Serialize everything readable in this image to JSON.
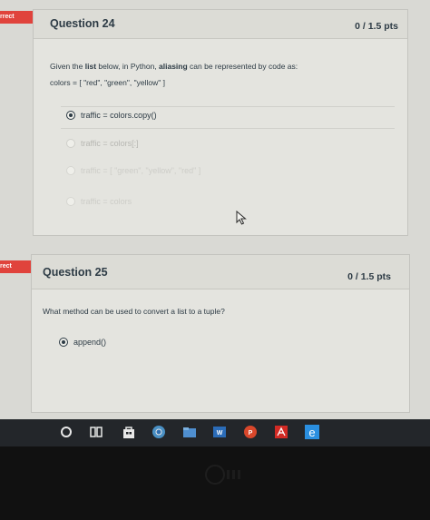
{
  "question24": {
    "status": "rrect",
    "title": "Question 24",
    "points": "0 / 1.5 pts",
    "prompt_start": "Given the ",
    "prompt_bold1": "list",
    "prompt_mid": " below, in Python, ",
    "prompt_bold2": "aliasing",
    "prompt_end": " can be represented by code as:",
    "code_line": "colors = [ \"red\", \"green\", \"yellow\" ]",
    "answers": [
      {
        "label": "traffic = colors.copy()",
        "selected": true
      },
      {
        "label": "traffic = colors[:]",
        "selected": false
      },
      {
        "label": "traffic = [ \"green\", \"yellow\", \"red\" ]",
        "selected": false
      },
      {
        "label": "traffic = colors",
        "selected": false
      }
    ]
  },
  "question25": {
    "status": "rect",
    "title": "Question 25",
    "points": "0 / 1.5 pts",
    "prompt": "What method can be used to convert a list to a tuple?",
    "answers": [
      {
        "label": "append()",
        "selected": true
      }
    ]
  },
  "taskbar": {
    "icons": [
      "search-icon",
      "task-view-icon",
      "store-icon",
      "chrome-icon",
      "file-explorer-icon",
      "word-icon",
      "powerpoint-icon",
      "acrobat-icon",
      "edge-icon"
    ]
  },
  "colors": {
    "incorrect_tag": "#e0433c",
    "text": "#2d3b45"
  }
}
